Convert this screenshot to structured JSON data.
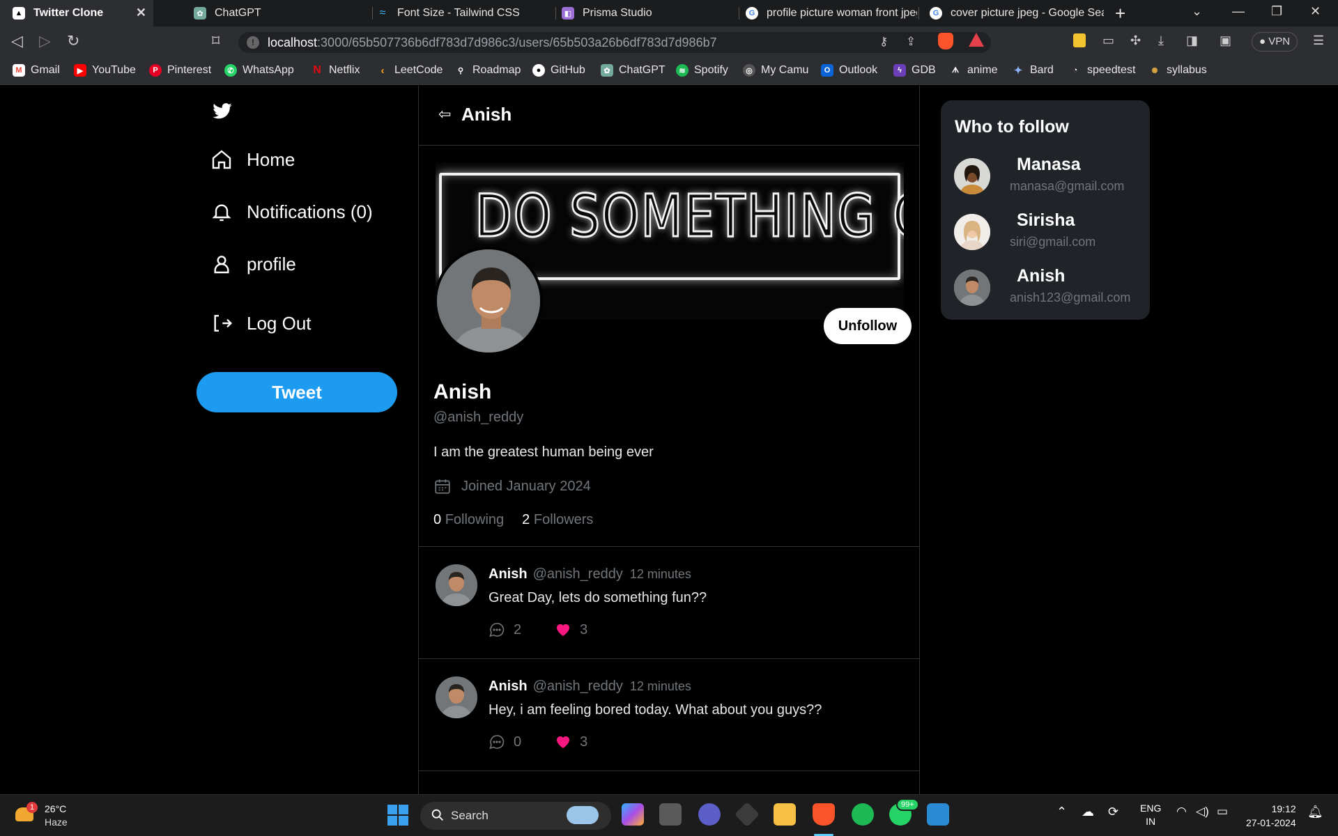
{
  "browser": {
    "tabs": [
      {
        "label": "Twitter Clone",
        "icon": "twitter-clone-favicon"
      },
      {
        "label": "ChatGPT",
        "icon": "chatgpt-favicon"
      },
      {
        "label": "Font Size - Tailwind CSS",
        "icon": "tailwind-favicon"
      },
      {
        "label": "Prisma Studio",
        "icon": "prisma-favicon"
      },
      {
        "label": "profile picture woman front jpeg",
        "icon": "google-favicon"
      },
      {
        "label": "cover picture jpeg - Google Sear",
        "icon": "google-favicon"
      }
    ],
    "url_host": "localhost",
    "url_path": ":3000/65b507736b6df783d7d986c3/users/65b503a26b6df783d7d986b7",
    "vpn_label": "VPN",
    "bookmarks": [
      "Gmail",
      "YouTube",
      "Pinterest",
      "WhatsApp",
      "Netflix",
      "LeetCode",
      "Roadmap",
      "GitHub",
      "ChatGPT",
      "Spotify",
      "My Camu",
      "Outlook",
      "GDB",
      "anime",
      "Bard",
      "speedtest",
      "syllabus"
    ]
  },
  "sidebar": {
    "items": [
      {
        "label": "Home",
        "icon": "home-icon"
      },
      {
        "label": "Notifications (0)",
        "icon": "bell-icon"
      },
      {
        "label": "profile",
        "icon": "user-icon"
      },
      {
        "label": "Log Out",
        "icon": "logout-icon"
      }
    ],
    "tweet_button": "Tweet"
  },
  "profile": {
    "header_title": "Anish",
    "cover_text": "DO SOMETHING GREAT",
    "unfollow_label": "Unfollow",
    "name": "Anish",
    "handle": "@anish_reddy",
    "bio": "I am the greatest human being ever",
    "joined": "Joined January 2024",
    "following_count": "0",
    "following_label": "Following",
    "followers_count": "2",
    "followers_label": "Followers"
  },
  "posts": [
    {
      "name": "Anish",
      "handle": "@anish_reddy",
      "time": "12 minutes",
      "text": "Great Day, lets do something fun??",
      "replies": "2",
      "likes": "3"
    },
    {
      "name": "Anish",
      "handle": "@anish_reddy",
      "time": "12 minutes",
      "text": "Hey, i am feeling bored today. What about you guys??",
      "replies": "0",
      "likes": "3"
    }
  ],
  "who_to_follow": {
    "title": "Who to follow",
    "users": [
      {
        "name": "Manasa",
        "email": "manasa@gmail.com"
      },
      {
        "name": "Sirisha",
        "email": "siri@gmail.com"
      },
      {
        "name": "Anish",
        "email": "anish123@gmail.com"
      }
    ]
  },
  "taskbar": {
    "weather_badge": "1",
    "temperature": "26°C",
    "condition": "Haze",
    "search_label": "Search",
    "notification_badge": "99+",
    "language_top": "ENG",
    "language_bottom": "IN",
    "time": "19:12",
    "date": "27-01-2024"
  },
  "colors": {
    "accent": "#1d9bf0",
    "like_heart": "#f91880",
    "background": "#000000",
    "card": "#202327",
    "muted_text": "#71767b"
  }
}
